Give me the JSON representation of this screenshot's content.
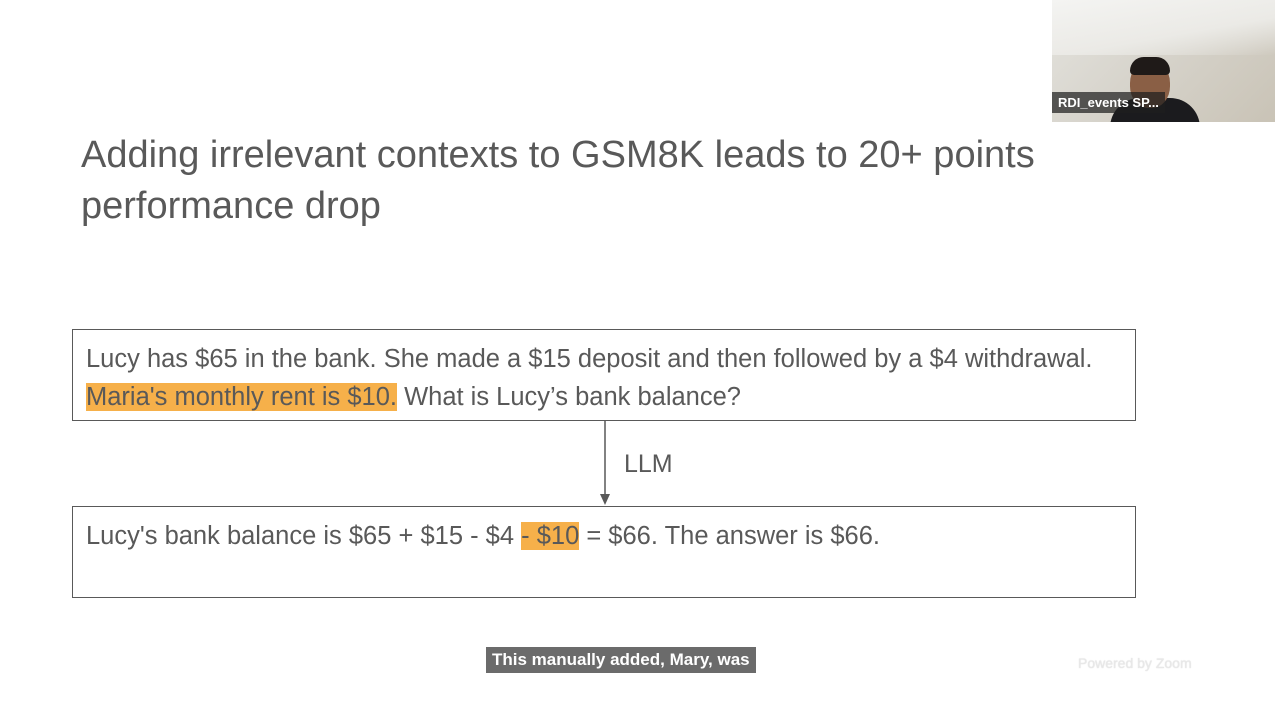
{
  "slide": {
    "title": "Adding irrelevant contexts to GSM8K leads to 20+ points performance drop",
    "question": {
      "before": "Lucy has $65 in the bank. She made a $15 deposit and then followed by a $4 withdrawal. ",
      "highlight": "Maria's monthly rent is $10.",
      "after": " What is Lucy’s bank balance?"
    },
    "arrow_label": "LLM",
    "answer": {
      "before": "Lucy's bank balance is $65 + $15 - $4 ",
      "highlight": "- $10",
      "after": " = $66. The answer is $66."
    },
    "highlight_color": "#f6b04a"
  },
  "video": {
    "participant_name": "RDI_events SP..."
  },
  "caption": {
    "text": "This manually added, Mary, was"
  },
  "watermark": {
    "text": "Powered by Zoom"
  }
}
